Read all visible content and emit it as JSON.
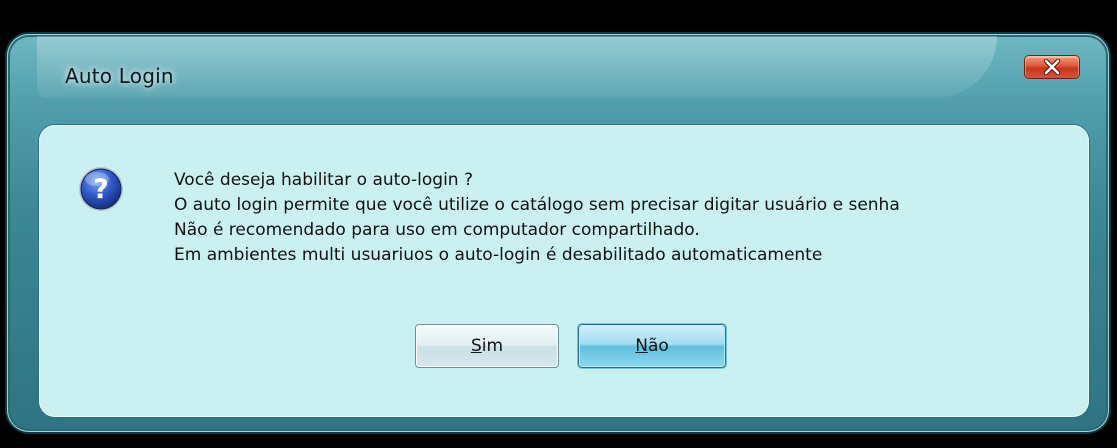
{
  "dialog": {
    "title": "Auto Login",
    "close_icon": "close-x-icon",
    "message_icon": "question-mark-icon",
    "message_lines": [
      "Você deseja habilitar o auto-login ?",
      "O auto login permite que você utilize o catálogo sem precisar digitar usuário e senha",
      "Não é recomendado para uso em computador compartilhado.",
      "Em ambientes multi usuariuos o auto-login é desabilitado automaticamente"
    ],
    "buttons": {
      "yes": {
        "accel": "S",
        "rest": "im"
      },
      "no": {
        "accel": "N",
        "rest": "ão"
      }
    }
  },
  "colors": {
    "background": "#000000",
    "frame": "#3b8796",
    "content": "#cbf0f2",
    "close_button": "#d9563a",
    "default_button": "#8fd6ee"
  }
}
